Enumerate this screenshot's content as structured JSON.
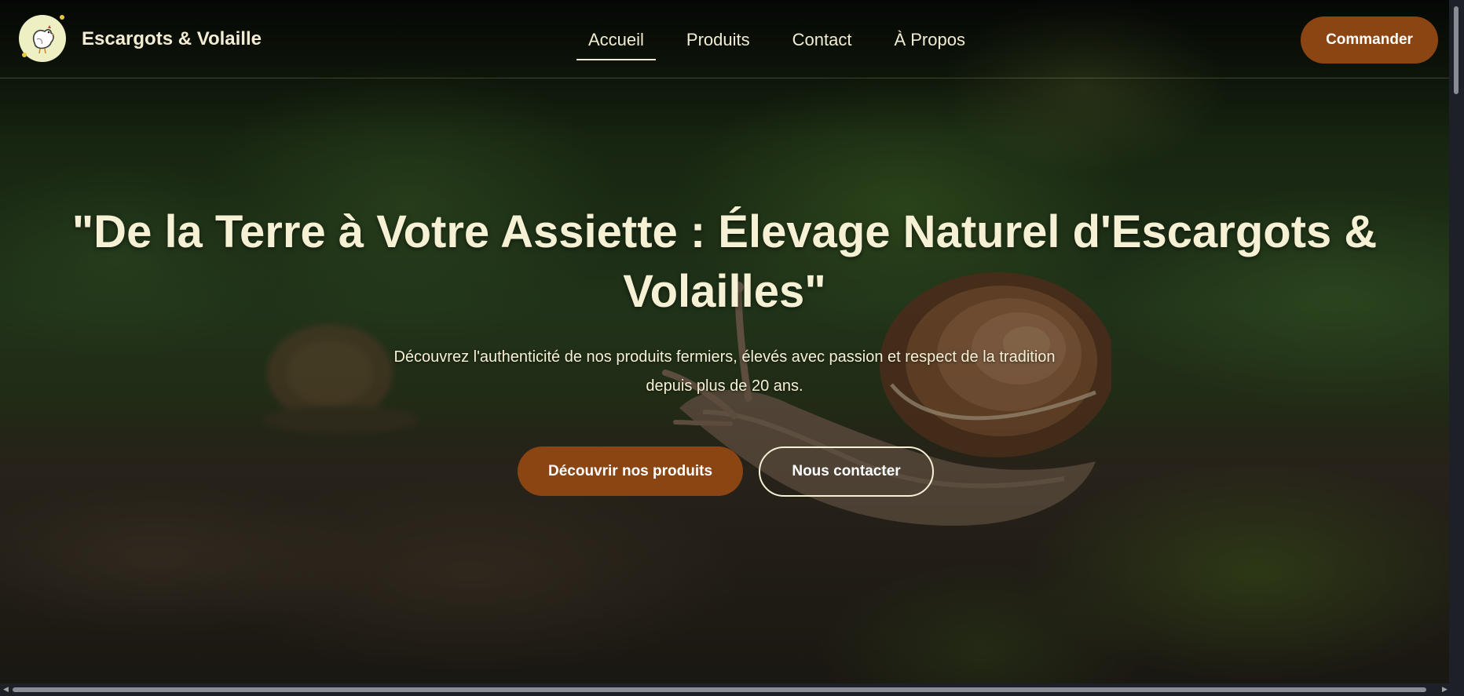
{
  "header": {
    "brand_name": "Escargots & Volaille",
    "logo_icon": "chicken-icon",
    "nav": [
      {
        "label": "Accueil",
        "active": true
      },
      {
        "label": "Produits",
        "active": false
      },
      {
        "label": "Contact",
        "active": false
      },
      {
        "label": "À Propos",
        "active": false
      }
    ],
    "cta_label": "Commander"
  },
  "hero": {
    "title": "\"De la Terre à Votre Assiette : Élevage Naturel d'Escargots & Volailles\"",
    "subtitle": "Découvrez l'authenticité de nos produits fermiers, élevés avec passion et respect de la tradition depuis plus de 20 ans.",
    "primary_button": "Découvrir nos produits",
    "secondary_button": "Nous contacter"
  },
  "colors": {
    "accent": "#8b4513",
    "text": "#f6f1d5",
    "logo_bg": "#eef0c4"
  }
}
